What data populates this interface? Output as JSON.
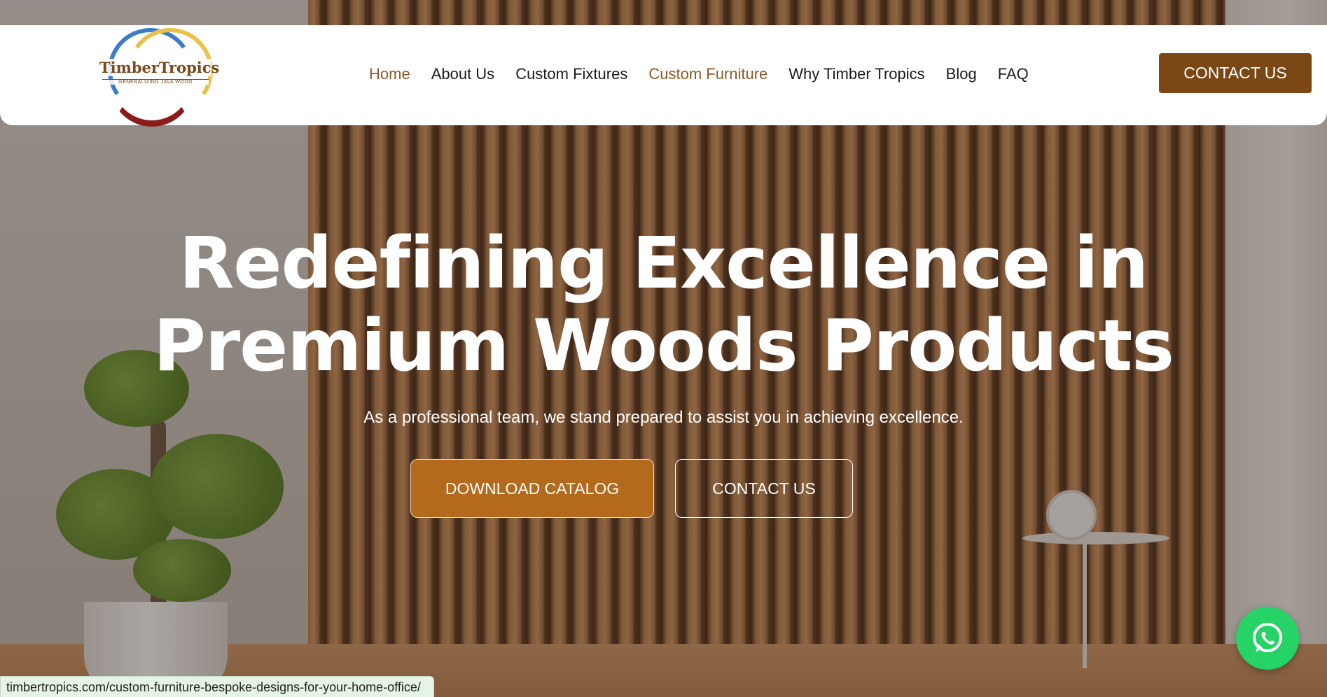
{
  "colors": {
    "brand_brown": "#7a4715",
    "catalog_button": "#b46a1d",
    "nav_active": "#8a5a28",
    "whatsapp_green": "#25d366"
  },
  "logo": {
    "name": "TimberTropics",
    "tagline": "GENERALIZING JAVA WOOD"
  },
  "nav": {
    "items": [
      {
        "label": "Home",
        "state": "active"
      },
      {
        "label": "About Us"
      },
      {
        "label": "Custom Fixtures"
      },
      {
        "label": "Custom Furniture",
        "state": "hover"
      },
      {
        "label": "Why Timber Tropics"
      },
      {
        "label": "Blog"
      },
      {
        "label": "FAQ"
      }
    ],
    "cta_label": "CONTACT US"
  },
  "hero": {
    "title_line1": "Redefining Excellence in",
    "title_line2": "Premium Woods Products",
    "subtitle": "As a professional team, we stand prepared to assist you in achieving excellence.",
    "primary_button": "DOWNLOAD CATALOG",
    "secondary_button": "CONTACT US"
  },
  "whatsapp": {
    "icon": "whatsapp-icon"
  },
  "status_bar": {
    "url": "timbertropics.com/custom-furniture-bespoke-designs-for-your-home-office/"
  }
}
